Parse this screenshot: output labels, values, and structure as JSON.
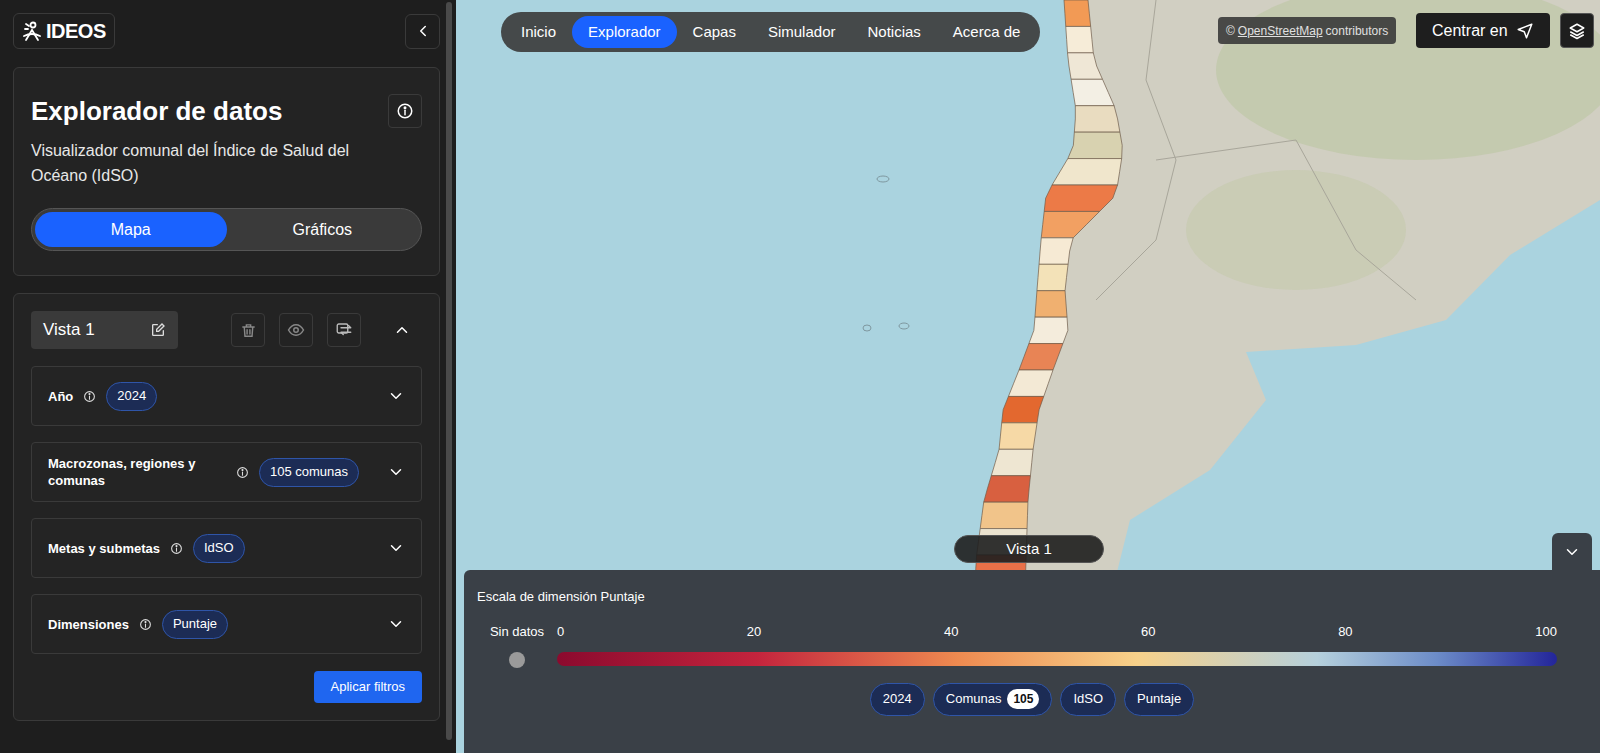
{
  "logo": {
    "text": "IDEOS"
  },
  "panel": {
    "title": "Explorador de datos",
    "subtitle": "Visualizador comunal del Índice de Salud del Océano (IdSO)",
    "modes": [
      {
        "label": "Mapa",
        "selected": true
      },
      {
        "label": "Gráficos",
        "selected": false
      }
    ]
  },
  "view": {
    "name": "Vista 1",
    "expanded": true,
    "filters": [
      {
        "label": "Año",
        "badge": "2024",
        "expanded": false
      },
      {
        "label": "Macrozonas, regiones y comunas",
        "badge": "105 comunas",
        "expanded": false
      },
      {
        "label": "Metas y submetas",
        "badge": "IdSO",
        "expanded": false
      },
      {
        "label": "Dimensiones",
        "badge": "Puntaje",
        "expanded": false
      }
    ],
    "apply": "Aplicar filtros"
  },
  "nav": [
    {
      "label": "Inicio",
      "selected": false
    },
    {
      "label": "Explorador",
      "selected": true
    },
    {
      "label": "Capas",
      "selected": false
    },
    {
      "label": "Simulador",
      "selected": false
    },
    {
      "label": "Noticias",
      "selected": false
    },
    {
      "label": "Acerca de",
      "selected": false
    }
  ],
  "attribution": {
    "symbol": "©",
    "link": "OpenStreetMap",
    "text": "contributors"
  },
  "center_button": "Centrar en",
  "map": {
    "view_label": "Vista 1",
    "comunas": [
      {
        "color": "#f29a55"
      },
      {
        "color": "#f6ecd8"
      },
      {
        "color": "#efe7d6"
      },
      {
        "color": "#f3efe4"
      },
      {
        "color": "#e9dcc0"
      },
      {
        "color": "#d8d2b0"
      },
      {
        "color": "#f0e6cc"
      },
      {
        "color": "#ec7a47"
      },
      {
        "color": "#f2a062"
      },
      {
        "color": "#f6ead4"
      },
      {
        "color": "#f3e2b8"
      },
      {
        "color": "#f0b070"
      },
      {
        "color": "#f4ecdc"
      },
      {
        "color": "#e88455"
      },
      {
        "color": "#f3e9d5"
      },
      {
        "color": "#e3682f"
      },
      {
        "color": "#f6d9a6"
      },
      {
        "color": "#eee6d2"
      },
      {
        "color": "#d86040"
      },
      {
        "color": "#f1c48a"
      },
      {
        "color": "#ebe3cf"
      },
      {
        "color": "#e87048"
      },
      {
        "color": "#c9d2c6"
      },
      {
        "color": "#f3d08f"
      },
      {
        "color": "#e7ddc4"
      },
      {
        "color": "#cf4f35"
      },
      {
        "color": "#e0d8bc"
      },
      {
        "color": "#f0c07a"
      }
    ]
  },
  "legend": {
    "title": "Escala de dimensión Puntaje",
    "no_data": "Sin datos",
    "ticks": [
      "0",
      "20",
      "40",
      "60",
      "80",
      "100"
    ],
    "chips": [
      {
        "label": "2024"
      },
      {
        "label": "Comunas",
        "count": "105"
      },
      {
        "label": "IdSO"
      },
      {
        "label": "Puntaje"
      }
    ]
  }
}
